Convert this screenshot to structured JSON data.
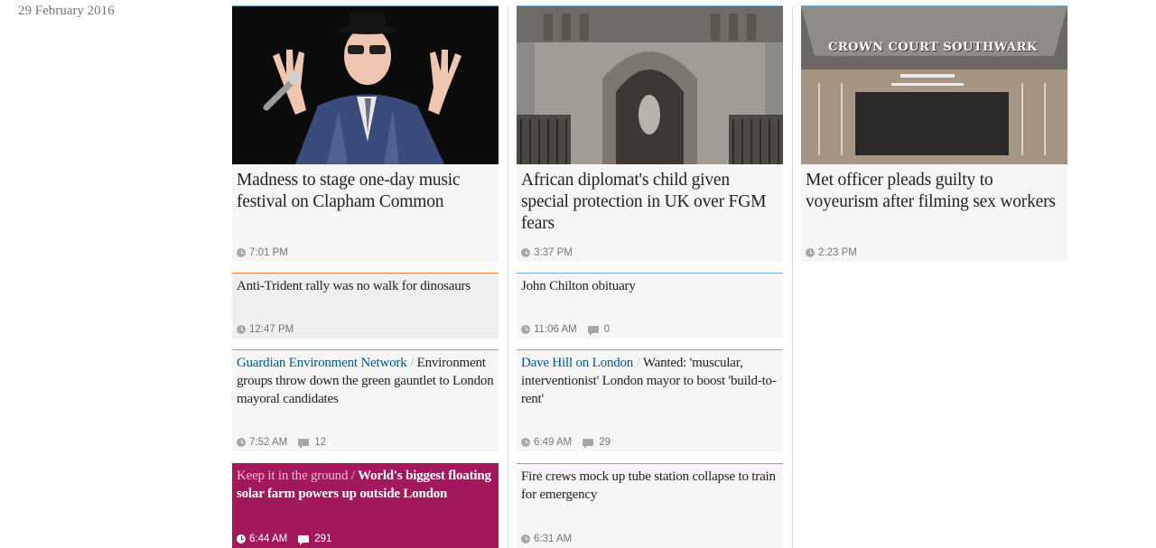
{
  "section": {
    "date": "29 February 2016"
  },
  "featured": [
    {
      "headline": "Madness to stage one-day music festival on Clapham Common",
      "time": "7:01 PM",
      "image": "man-in-pinstripe-suit-with-microphone"
    },
    {
      "headline": "African diplomat's child given special protection in UK over FGM fears",
      "time": "3:37 PM",
      "image": "royal-courts-of-justice-gothic-entrance"
    },
    {
      "headline": "Met officer pleads guilty to voyeurism after filming sex workers",
      "time": "2:23 PM",
      "image": "crown-court-southwark-building",
      "sign_text": "CROWN COURT SOUTHWARK"
    }
  ],
  "list": [
    {
      "headline": "Anti-Trident rally was no walk for dinosaurs",
      "time": "12:47 PM"
    },
    {
      "headline": "John Chilton obituary",
      "time": "11:06 AM",
      "comments": "0"
    },
    {
      "kicker": "Guardian Environment Network",
      "headline": "Environment groups throw down the green gauntlet to London mayoral candidates",
      "time": "7:52 AM",
      "comments": "12"
    },
    {
      "kicker": "Dave Hill on London",
      "headline": "Wanted: 'muscular, interventionist' London mayor to boost 'build-to-rent'",
      "time": "6:49 AM",
      "comments": "29"
    },
    {
      "kicker": "Keep it in the ground",
      "headline": "World's biggest floating solar farm powers up outside London",
      "time": "6:44 AM",
      "comments": "291"
    },
    {
      "headline": "Fire crews mock up tube station collapse to train for emergency",
      "time": "6:31 AM"
    }
  ],
  "separator": "/",
  "colors": {
    "accent_border": "#6fb1c9",
    "opinion_border": "#e0823c",
    "feature_background": "#a1185c",
    "kicker": "#005689",
    "card_background": "#f6f6f6"
  }
}
